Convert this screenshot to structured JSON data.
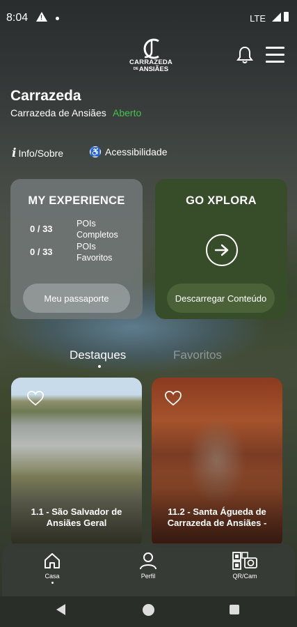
{
  "status_bar": {
    "time": "8:04",
    "network": "LTE"
  },
  "header": {
    "logo_line1": "CARRAZEDA",
    "logo_line2": "ANSIÃES",
    "logo_de": "DE"
  },
  "place": {
    "title": "Carrazeda",
    "subtitle": "Carrazeda de Ansiães",
    "status": "Aberto",
    "status_color": "#46c24f"
  },
  "links": {
    "info": "Info/Sobre",
    "accessibility": "Acessibilidade"
  },
  "my_experience": {
    "title": "MY EXPERIENCE",
    "stats": [
      {
        "value": "0 / 33",
        "label": "POIs Completos"
      },
      {
        "value": "0 / 33",
        "label": "POIs Favoritos"
      }
    ],
    "button": "Meu passaporte"
  },
  "go_xplora": {
    "title": "GO XPLORA",
    "button": "Descarregar Conteúdo",
    "icon": "arrow-right-icon"
  },
  "tabs": {
    "highlights": "Destaques",
    "favorites": "Favoritos",
    "active": "Destaques"
  },
  "pois": [
    {
      "title": "1.1 - São Salvador de Ansiães Geral"
    },
    {
      "title": "11.2 - Santa Águeda de Carrazeda de Ansiães -"
    }
  ],
  "bottom_nav": [
    {
      "label": "Casa",
      "icon": "home-icon"
    },
    {
      "label": "Perfil",
      "icon": "user-icon"
    },
    {
      "label": "QR/Cam",
      "icon": "qr-camera-icon"
    }
  ]
}
